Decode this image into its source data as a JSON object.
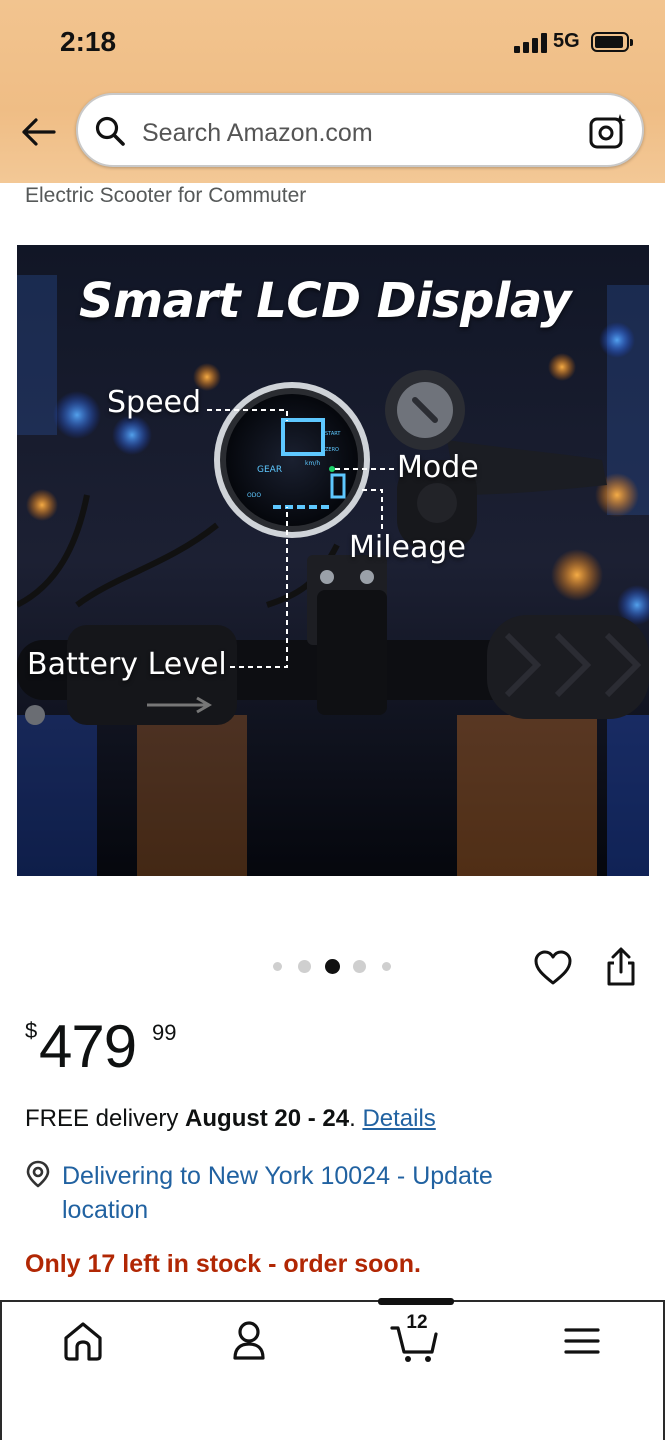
{
  "status_bar": {
    "time": "2:18",
    "network": "5G"
  },
  "header": {
    "search_placeholder": "Search Amazon.com",
    "back_icon": "arrow-left-icon",
    "search_icon": "search-icon",
    "camera_icon": "camera-lens-icon"
  },
  "product": {
    "subtitle": "Electric Scooter for Commuter",
    "image": {
      "title": "Smart LCD Display",
      "labels": {
        "speed": "Speed",
        "mode": "Mode",
        "mileage": "Mileage",
        "battery": "Battery Level"
      },
      "display": {
        "speed": "00",
        "gear_text": "GEAR",
        "odo_text": "ODO",
        "unit": "km/h",
        "start": "START",
        "zero": "ZERO",
        "mode_digit": "0",
        "km": "km"
      }
    },
    "carousel": {
      "count": 5,
      "active_index": 2
    },
    "price": {
      "symbol": "$",
      "whole": "479",
      "fraction": "99"
    },
    "delivery": {
      "prefix": "FREE delivery ",
      "dates": "August 20 - 24",
      "suffix": ". ",
      "details_link": "Details"
    },
    "location": {
      "text": "Delivering to New York 10024 - Update location",
      "icon": "location-pin-icon"
    },
    "stock": "Only 17 left in stock - order soon."
  },
  "tabbar": {
    "items": [
      {
        "name": "Home",
        "icon": "home-icon"
      },
      {
        "name": "Account",
        "icon": "person-icon"
      },
      {
        "name": "Cart",
        "icon": "cart-icon",
        "count": "12"
      },
      {
        "name": "Menu",
        "icon": "hamburger-menu-icon"
      }
    ],
    "active": "Cart"
  },
  "colors": {
    "header_bg": "#efbd85",
    "link": "#2162a1",
    "stock_warning": "#b12704",
    "text": "#0f1111"
  }
}
